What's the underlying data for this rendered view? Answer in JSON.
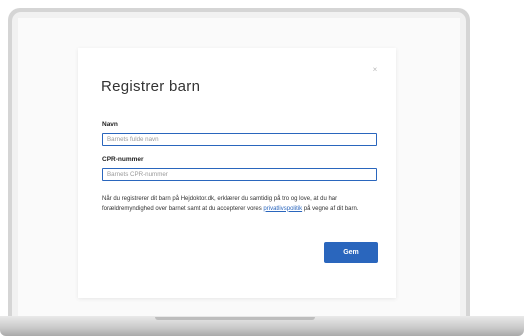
{
  "modal": {
    "title": "Registrer barn",
    "close_symbol": "×",
    "name_field": {
      "label": "Navn",
      "placeholder": "Barnets fulde navn",
      "value": ""
    },
    "cpr_field": {
      "label": "CPR-nummer",
      "placeholder": "Barnets CPR-nummer",
      "value": ""
    },
    "consent": {
      "text_before": "Når du registrerer dit barn på Hejdoktor.dk, erklærer du samtidig på tro og love, at du har forældremyndighed over barnet samt at du accepterer vores ",
      "link_text": "privatlivspolitik",
      "text_after": " på vegne af dit barn."
    },
    "save_label": "Gem"
  },
  "colors": {
    "accent": "#2a66bd",
    "text": "#333333",
    "placeholder": "#9a9a9a"
  }
}
